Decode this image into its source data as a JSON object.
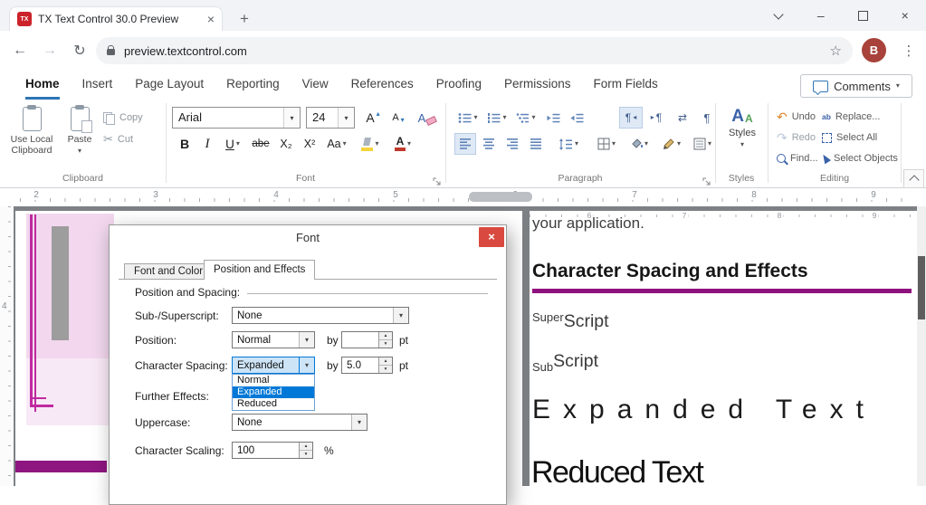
{
  "browser": {
    "tab_title": "TX Text Control 30.0 Preview",
    "favicon": "TX",
    "url": "preview.textcontrol.com",
    "avatar": "B"
  },
  "icons": {
    "dropdown": "▾",
    "up": "▴",
    "down": "▾",
    "close": "×",
    "back": "←",
    "forward": "→",
    "reload": "↻",
    "star": "☆",
    "menu": "⋮",
    "plus": "+",
    "minimize": "–",
    "scissors": "✂",
    "undo": "↶",
    "redo": "↷",
    "pilcrow": "¶",
    "tri_left": "◂",
    "tri_right": "▸",
    "swap": "⇄"
  },
  "ribbon_tabs": [
    {
      "label": "Home",
      "active": true
    },
    {
      "label": "Insert",
      "active": false
    },
    {
      "label": "Page Layout",
      "active": false
    },
    {
      "label": "Reporting",
      "active": false
    },
    {
      "label": "View",
      "active": false
    },
    {
      "label": "References",
      "active": false
    },
    {
      "label": "Proofing",
      "active": false
    },
    {
      "label": "Permissions",
      "active": false
    },
    {
      "label": "Form Fields",
      "active": false
    }
  ],
  "comments_label": "Comments",
  "ribbon": {
    "clipboard": {
      "group": "Clipboard",
      "use_local_line1": "Use Local",
      "use_local_line2": "Clipboard",
      "paste": "Paste",
      "copy": "Copy",
      "cut": "Cut"
    },
    "font": {
      "group": "Font",
      "family": "Arial",
      "size": "24",
      "grow": "A",
      "shrink": "A",
      "clear": "A",
      "bold": "B",
      "italic": "I",
      "underline": "U",
      "strike": "abe",
      "subscript": "X₂",
      "superscript": "X²",
      "change_case": "Aa",
      "color_letter": "A"
    },
    "paragraph": {
      "group": "Paragraph"
    },
    "styles": {
      "group": "Styles",
      "label": "Styles",
      "a_large": "A",
      "a_small": "A"
    },
    "editing": {
      "group": "Editing",
      "undo": "Undo",
      "redo": "Redo",
      "find": "Find...",
      "replace": "Replace...",
      "select_all": "Select All",
      "select_objects": "Select Objects"
    }
  },
  "ruler": {
    "h_numbers": [
      "2",
      "3",
      "4",
      "5",
      "6",
      "7",
      "8",
      "9"
    ],
    "right_numbers": [
      "6",
      "7",
      "8",
      "9"
    ],
    "v_number": "4"
  },
  "dialog": {
    "title": "Font",
    "tab_font_color": "Font and Color",
    "tab_position_effects": "Position and Effects",
    "section": "Position and Spacing:",
    "sub_super_label": "Sub-/Superscript:",
    "sub_super_value": "None",
    "position_label": "Position:",
    "position_value": "Normal",
    "by1": "by",
    "position_by": "",
    "pt1": "pt",
    "char_spacing_label": "Character Spacing:",
    "char_spacing_value": "Expanded",
    "by2": "by",
    "char_spacing_by": "5.0",
    "pt2": "pt",
    "list_options": [
      "Normal",
      "Expanded",
      "Reduced"
    ],
    "further_effects_label": "Further Effects:",
    "uppercase_label": "Uppercase:",
    "uppercase_value": "None",
    "char_scaling_label": "Character Scaling:",
    "char_scaling_value": "100",
    "percent": "%"
  },
  "document": {
    "intro": "your application.",
    "heading": "Character Spacing and Effects",
    "super_prefix": "Super",
    "super_word": "Script",
    "sub_prefix": "Sub",
    "sub_word": "Script",
    "expanded": "Expanded Text",
    "reduced": "Reduced Text"
  },
  "colors": {
    "brand_purple": "#8e117e",
    "selection_blue": "#0078d7",
    "close_red": "#d9493f",
    "ribbon_accent": "#2e75b6",
    "graphic_pink": "#f2d7ee",
    "graphic_magenta": "#bf2aa0"
  }
}
